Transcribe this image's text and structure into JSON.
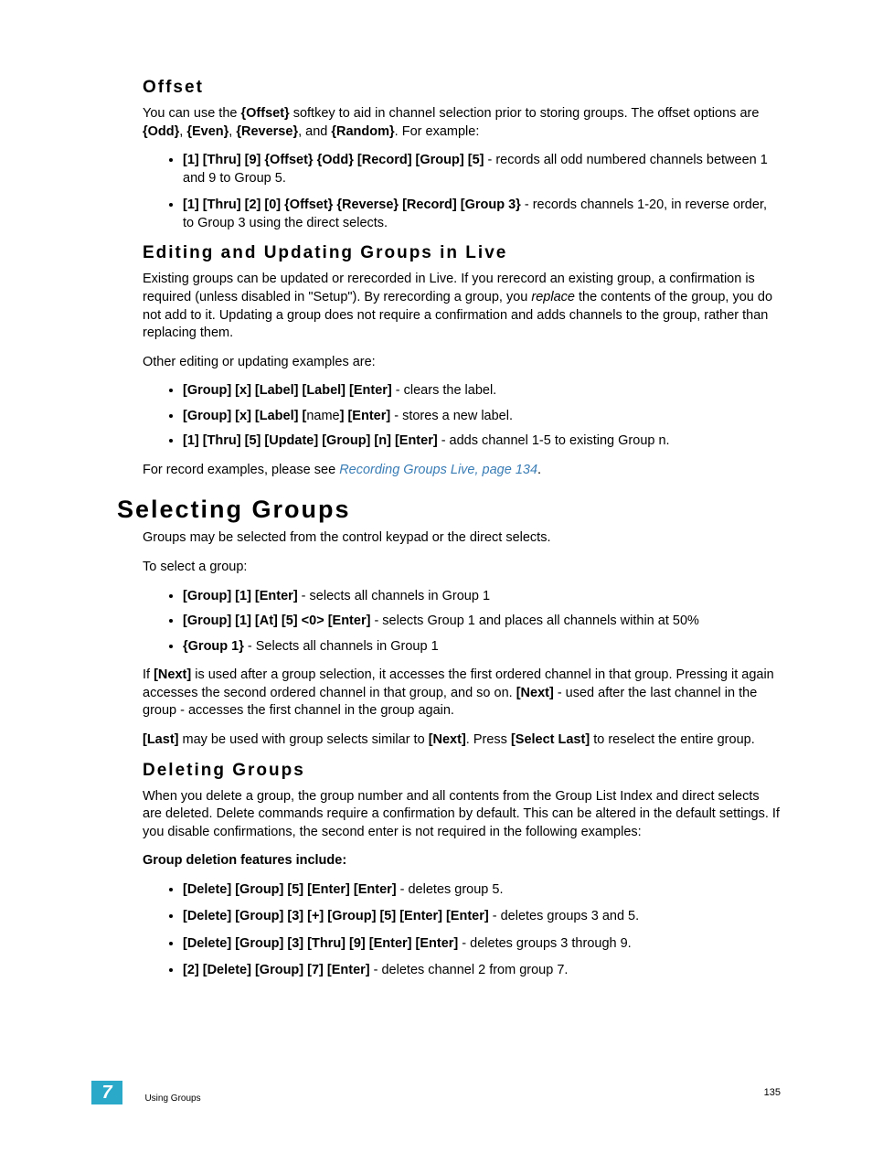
{
  "sections": {
    "offset": {
      "title": "Offset",
      "p1_a": "You can use the ",
      "p1_b": "{Offset}",
      "p1_c": " softkey to aid in channel selection prior to storing groups. The offset options are ",
      "p1_d": "{Odd}",
      "p1_e": ", ",
      "p1_f": "{Even}",
      "p1_g": ", ",
      "p1_h": "{Reverse}",
      "p1_i": ", and ",
      "p1_j": "{Random}",
      "p1_k": ". For example:",
      "li1_b": "[1] [Thru] [9] {Offset} {Odd} [Record] [Group] [5]",
      "li1_t": " - records all odd numbered channels between 1 and 9 to Group 5.",
      "li2_b": "[1] [Thru] [2] [0] {Offset} {Reverse} [Record] [Group 3}",
      "li2_t": " - records channels 1-20, in reverse order, to Group 3 using the direct selects."
    },
    "editing": {
      "title": "Editing and Updating Groups in Live",
      "p1_a": "Existing groups can be updated or rerecorded in Live. If you rerecord an existing group, a confirmation is required (unless disabled in \"Setup\"). By rerecording a group, you ",
      "p1_b": "replace",
      "p1_c": " the contents of the group, you do not add to it. Updating a group does not require a confirmation and adds channels to the group, rather than replacing them.",
      "p2": "Other editing or updating examples are:",
      "li1_b": "[Group] [x] [Label] [Label] [Enter]",
      "li1_t": " - clears the label.",
      "li2_b1": "[Group] [x] [Label] [",
      "li2_n": "name",
      "li2_b2": "] [Enter]",
      "li2_t": " - stores a new label.",
      "li3_b": "[1] [Thru] [5] [Update] [Group] [n] [Enter]",
      "li3_t": " - adds channel 1-5 to existing Group n.",
      "p3_a": "For record examples, please see ",
      "p3_link": "Recording Groups Live, page 134",
      "p3_c": "."
    },
    "selecting": {
      "title": "Selecting Groups",
      "p1": "Groups may be selected from the control keypad or the direct selects.",
      "p2": "To select a group:",
      "li1_b": "[Group] [1] [Enter]",
      "li1_t": " - selects all channels in Group 1",
      "li2_b": "[Group] [1] [At] [5] <0> [Enter]",
      "li2_t": " - selects Group 1 and places all channels within at 50%",
      "li3_b": "{Group 1}",
      "li3_t": " - Selects all channels in Group 1",
      "p3_a": "If ",
      "p3_b": "[Next]",
      "p3_c": " is used after a group selection, it accesses the first ordered channel in that group. Pressing it again accesses the second ordered channel in that group, and so on. ",
      "p3_d": "[Next]",
      "p3_e": " - used after the last channel in the group - accesses the first channel in the group again.",
      "p4_a": "[Last]",
      "p4_b": " may be used with group selects similar to ",
      "p4_c": "[Next]",
      "p4_d": ". Press ",
      "p4_e": "[Select Last]",
      "p4_f": " to reselect the entire group."
    },
    "deleting": {
      "title": "Deleting Groups",
      "p1": "When you delete a group, the group number and all contents from the Group List Index and direct selects are deleted. Delete commands require a confirmation by default. This can be altered in the default settings. If you disable confirmations, the second enter is not required in the following examples:",
      "p2": "Group deletion features include:",
      "li1_b": "[Delete] [Group] [5] [Enter] [Enter]",
      "li1_t": " - deletes group 5.",
      "li2_b": "[Delete] [Group] [3] [+] [Group] [5] [Enter] [Enter]",
      "li2_t": " - deletes groups 3 and 5.",
      "li3_b": "[Delete] [Group] [3] [Thru] [9] [Enter] [Enter]",
      "li3_t": " - deletes groups 3 through 9.",
      "li4_b": "[2] [Delete] [Group] [7] [Enter]",
      "li4_t": " - deletes channel 2 from group 7."
    }
  },
  "footer": {
    "chapter": "7",
    "label": "Using Groups",
    "page": "135"
  }
}
